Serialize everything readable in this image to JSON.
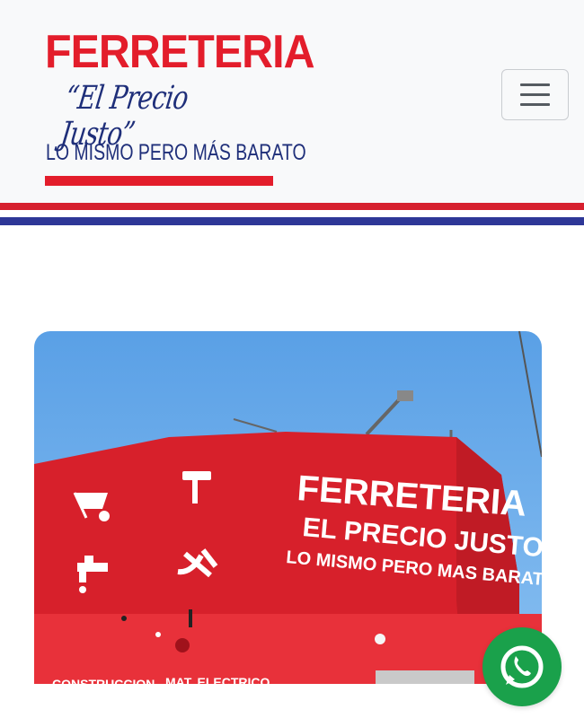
{
  "header": {
    "logo": {
      "title": "FERRETERIA",
      "script": "“El Precio Justo”",
      "slogan": "LO MISMO PERO MÁS BARATO"
    },
    "menu_icon": "hamburger-menu-icon"
  },
  "flag_colors": [
    "#d6202e",
    "#ffffff",
    "#2e3797"
  ],
  "hero_image": {
    "sign_lines": [
      "FERRETERIA",
      "EL PRECIO JUSTO",
      "LO MISMO PERO MAS BARATO"
    ],
    "sign_icons": [
      "wheelbarrow-icon",
      "paint-roller-icon",
      "faucet-icon",
      "tools-icon"
    ],
    "lower_sign_words": [
      "CONSTRUCCION",
      "MAT. ELECTRICO"
    ]
  },
  "floating": {
    "whatsapp_icon": "whatsapp-icon",
    "color": "#1aa14b"
  }
}
